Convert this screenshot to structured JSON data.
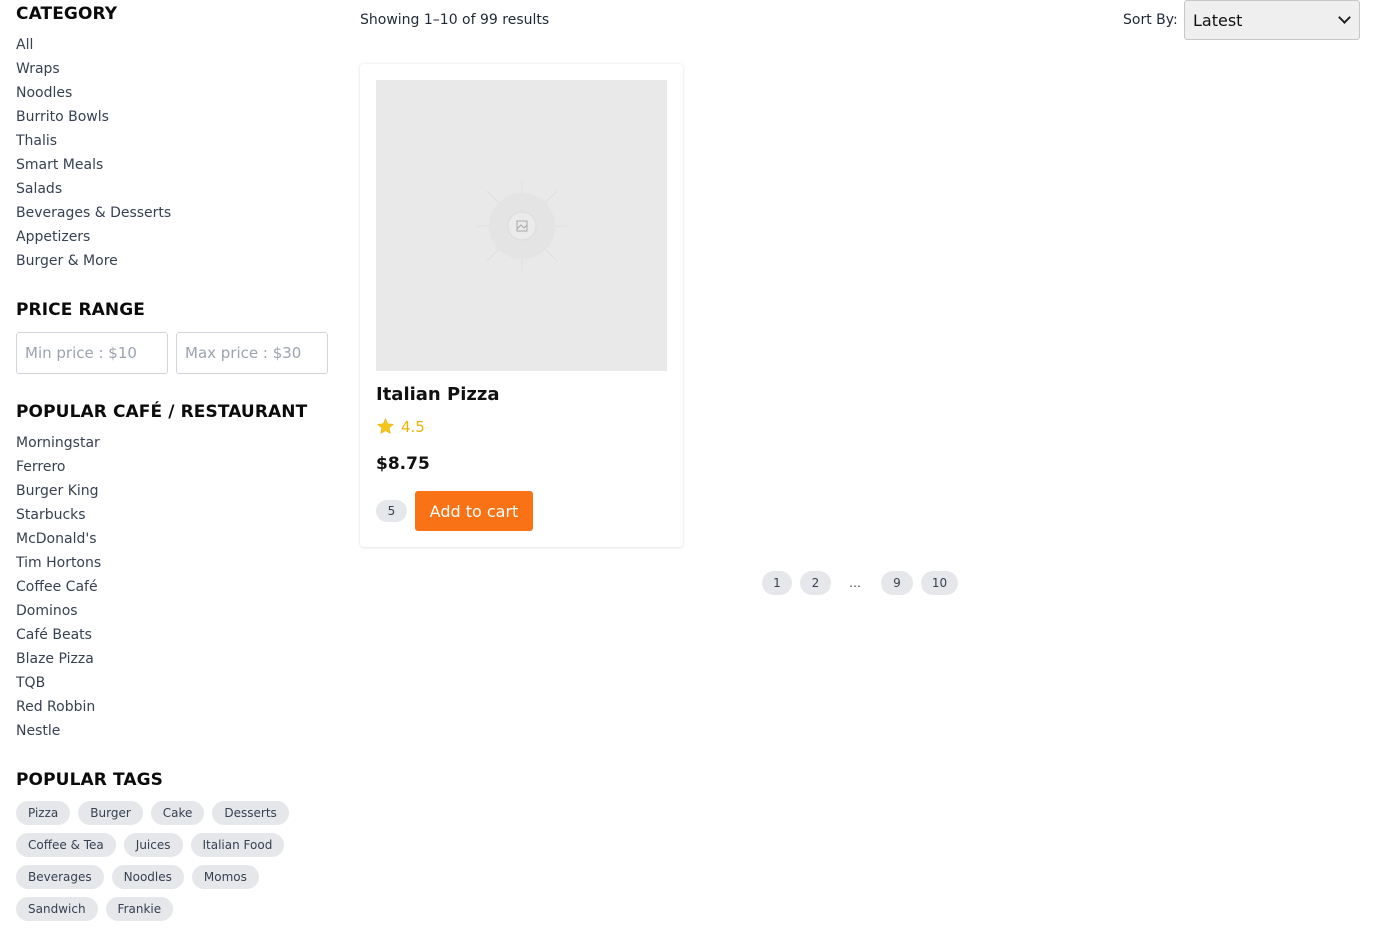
{
  "sidebar": {
    "category": {
      "title": "CATEGORY",
      "items": [
        "All",
        "Wraps",
        "Noodles",
        "Burrito Bowls",
        "Thalis",
        "Smart Meals",
        "Salads",
        "Beverages & Desserts",
        "Appetizers",
        "Burger & More"
      ]
    },
    "price_range": {
      "title": "PRICE RANGE",
      "min_placeholder": "Min price : $10",
      "max_placeholder": "Max price : $30"
    },
    "popular": {
      "title": "POPULAR CAFÉ / RESTAURANT",
      "items": [
        "Morningstar",
        "Ferrero",
        "Burger King",
        "Starbucks",
        "McDonald's",
        "Tim Hortons",
        "Coffee Café",
        "Dominos",
        "Café Beats",
        "Blaze Pizza",
        "TQB",
        "Red Robbin",
        "Nestle"
      ]
    },
    "tags": {
      "title": "POPULAR TAGS",
      "items": [
        "Pizza",
        "Burger",
        "Cake",
        "Desserts",
        "Coffee & Tea",
        "Juices",
        "Italian Food",
        "Beverages",
        "Noodles",
        "Momos",
        "Sandwich",
        "Frankie"
      ]
    }
  },
  "toolbar": {
    "results_text": "Showing 1–10 of 99 results",
    "sort_label": "Sort By:",
    "sort_value": "Latest"
  },
  "product": {
    "name": "Italian Pizza",
    "rating": "4.5",
    "price": "$8.75",
    "quantity": "5",
    "add_to_cart_label": "Add to cart",
    "image_icon": "image-placeholder-icon"
  },
  "pagination": {
    "pages": [
      "1",
      "2",
      "…",
      "9",
      "10"
    ]
  },
  "colors": {
    "accent": "#f97316",
    "star": "#eab308",
    "tag_bg": "#e5e7eb"
  }
}
